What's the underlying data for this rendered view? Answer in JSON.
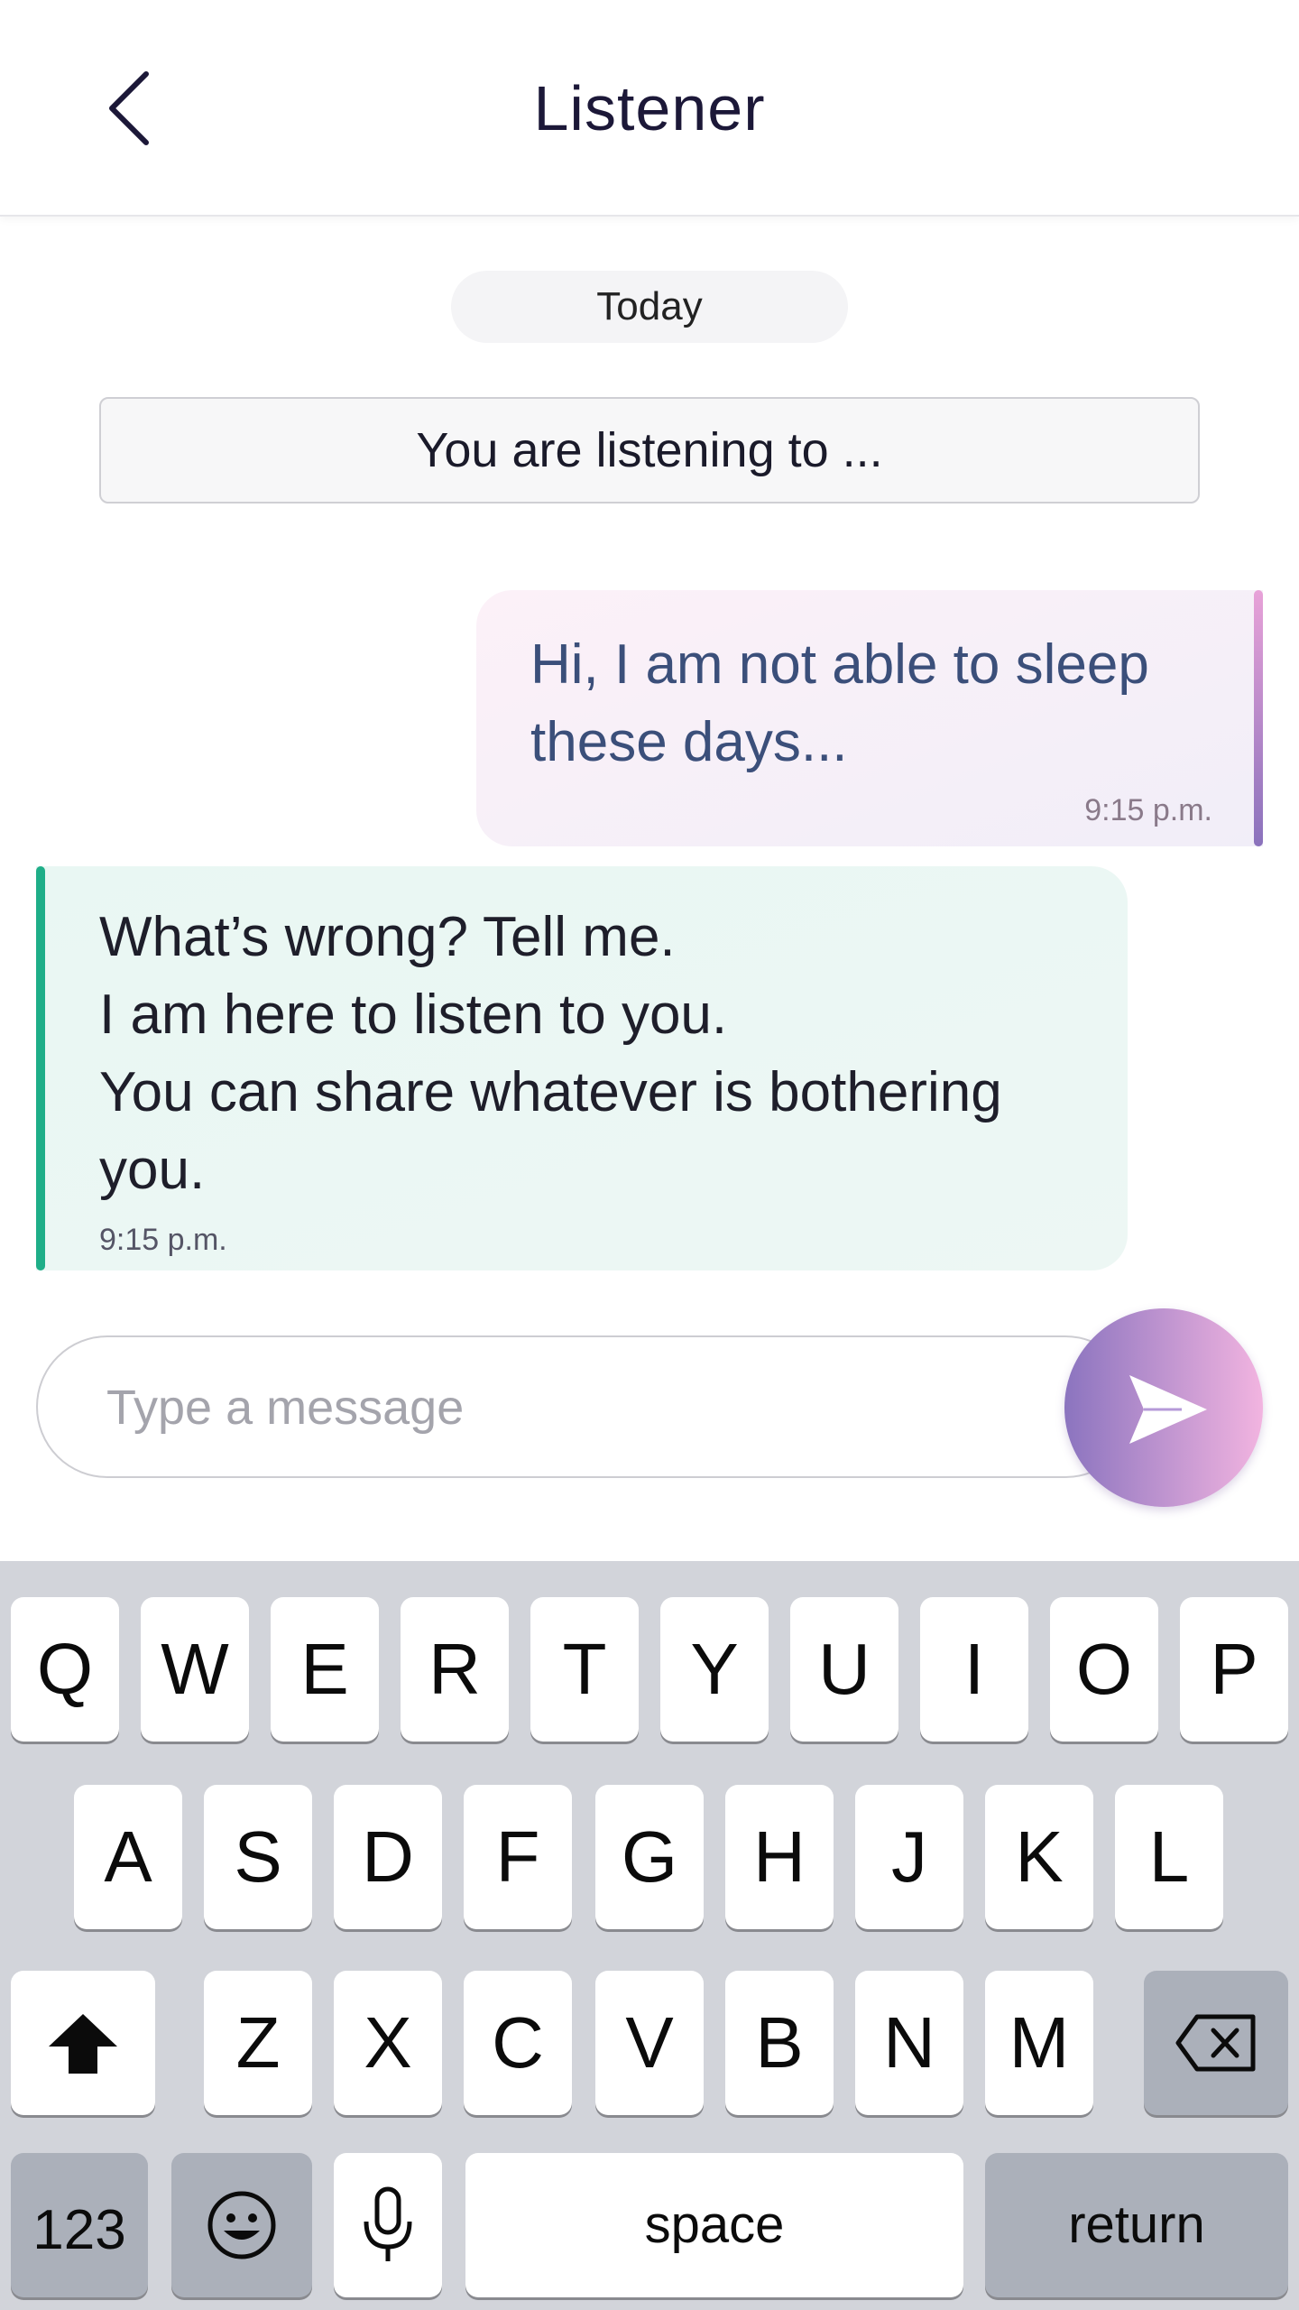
{
  "header": {
    "title": "Listener"
  },
  "chat": {
    "date_label": "Today",
    "notice": "You are listening to ...",
    "messages": [
      {
        "direction": "outgoing",
        "text": "Hi, I am not able to sleep these days...",
        "time": "9:15 p.m."
      },
      {
        "direction": "incoming",
        "text": "What’s wrong? Tell me.\nI am here to listen to you.\nYou can share whatever is bothering you.",
        "time": "9:15 p.m."
      }
    ]
  },
  "composer": {
    "placeholder": "Type a message",
    "value": ""
  },
  "keyboard": {
    "row1": [
      "Q",
      "W",
      "E",
      "R",
      "T",
      "Y",
      "U",
      "I",
      "O",
      "P"
    ],
    "row2": [
      "A",
      "S",
      "D",
      "F",
      "G",
      "H",
      "J",
      "K",
      "L"
    ],
    "row3": [
      "Z",
      "X",
      "C",
      "V",
      "B",
      "N",
      "M"
    ],
    "numbers_label": "123",
    "space_label": "space",
    "return_label": "return"
  },
  "icons": {
    "back": "chevron-left-icon",
    "send": "send-icon",
    "shift": "shift-arrow-icon",
    "delete": "backspace-icon",
    "emoji": "emoji-icon",
    "mic": "microphone-icon"
  },
  "colors": {
    "incoming_accent": "#1fae88",
    "outgoing_accent_start": "#e8a2d8",
    "outgoing_accent_end": "#8a72bc",
    "send_gradient_start": "#8b74bf",
    "send_gradient_end": "#f2b4e0"
  }
}
